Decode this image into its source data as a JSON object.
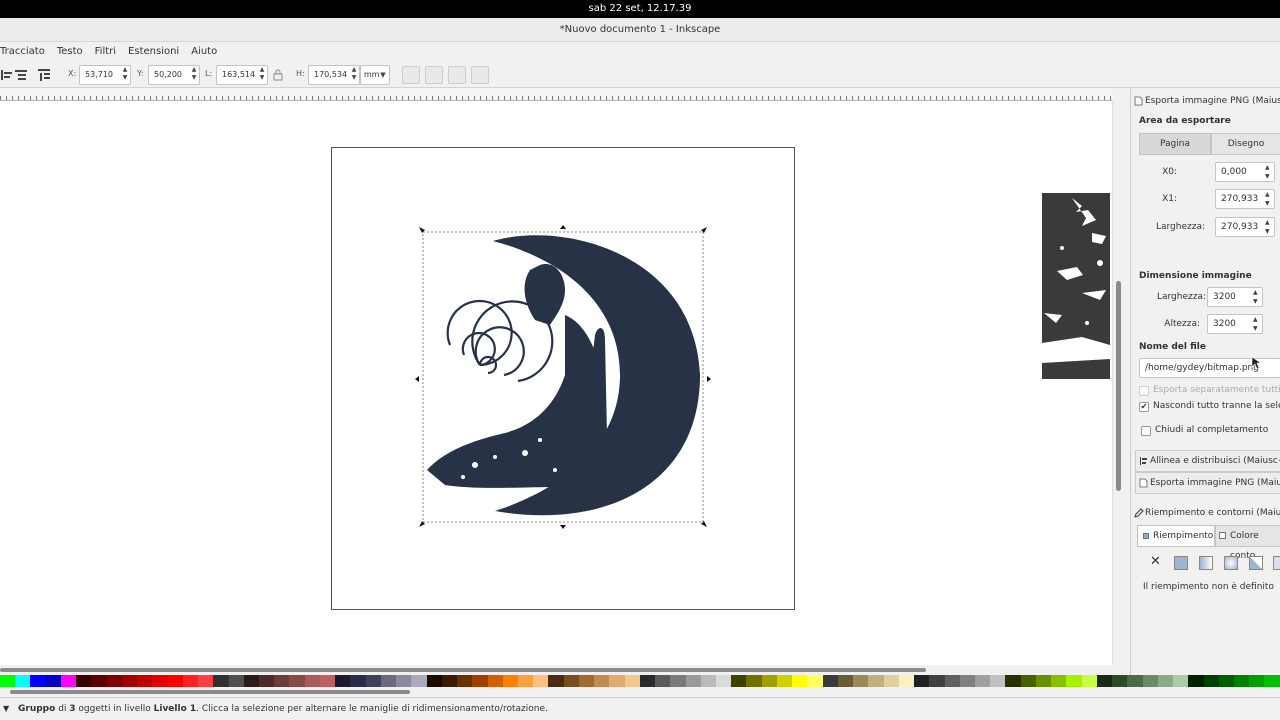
{
  "system": {
    "clock": "sab 22 set, 12.17.39"
  },
  "window": {
    "title": "*Nuovo documento 1 - Inkscape"
  },
  "menu": [
    "Tracciato",
    "Testo",
    "Filtri",
    "Estensioni",
    "Aiuto"
  ],
  "toolbar": {
    "x_label": "X:",
    "x_value": "53,710",
    "y_label": "Y:",
    "y_value": "50,200",
    "w_label": "L:",
    "w_value": "163,514",
    "h_label": "H:",
    "h_value": "170,534",
    "unit": "mm"
  },
  "export_panel": {
    "header": "Esporta immagine PNG (Maiusc+",
    "area_title": "Area da esportare",
    "tab_page": "Pagina",
    "tab_drawing": "Disegno",
    "x0_label": "X0:",
    "x0_value": "0,000",
    "x1_label": "X1:",
    "x1_value": "270,933",
    "width_label": "Larghezza:",
    "width_value": "270,933",
    "image_size_title": "Dimensione immagine",
    "img_width_label": "Larghezza:",
    "img_width_value": "3200",
    "img_height_label": "Altezza:",
    "img_height_value": "3200",
    "filename_title": "Nome del file",
    "filename_value": "/home/gydey/bitmap.png",
    "export_separately": "Esporta separatamente tutti gli",
    "hide_all_except": "Nascondi tutto tranne la selez",
    "close_when_done": "Chiudi al completamento",
    "hide_checked": true
  },
  "align_panel": {
    "header": "Allinea e distribuisci (Maiusc+C"
  },
  "export_panel_collapsed": {
    "header": "Esporta immagine PNG (Maiusc"
  },
  "fill_panel": {
    "header": "Riempimento e contorni (Maiusc",
    "tab_fill": "Riempimento",
    "tab_stroke": "Colore conto",
    "no_fill_icon": "x-icon",
    "undefined_text": "Il riempimento non è definito"
  },
  "status": {
    "prefix": "Gruppo",
    "di": "di",
    "count": "3",
    "objects_in_layer": "oggetti in livello",
    "layer": "Livello 1",
    "message": ". Clicca la selezione per alternare le maniglie di ridimensionamento/rotazione."
  },
  "colors": {
    "artwork": "#273247",
    "palette": [
      "#00ff00",
      "#00ffff",
      "#0000ff",
      "#0000c0",
      "#ff00ff",
      "#3b0000",
      "#5a0000",
      "#800000",
      "#a00000",
      "#c00000",
      "#e00000",
      "#ff0000",
      "#ff2020",
      "#ff4040",
      "#303030",
      "#505050",
      "#2b1a1a",
      "#4a2a2a",
      "#6b3a3a",
      "#8a4a4a",
      "#aa5a5a",
      "#c06060",
      "#1a1a2a",
      "#2a2a4a",
      "#40405a",
      "#6a6a7a",
      "#8a8a9a",
      "#aaaabb",
      "#1a0a00",
      "#3a1a00",
      "#6a3000",
      "#a04000",
      "#d06000",
      "#ff8000",
      "#ffa040",
      "#ffc080",
      "#4a2a10",
      "#7a4a20",
      "#a06a30",
      "#c08a50",
      "#e0aa70",
      "#f0c890",
      "#2a2a2a",
      "#5a5a5a",
      "#7a7a7a",
      "#9a9a9a",
      "#bababa",
      "#dadada",
      "#404000",
      "#707000",
      "#a0a000",
      "#d0d000",
      "#ffff00",
      "#ffff60",
      "#3a3a3a",
      "#6a5a3a",
      "#9a8a5a",
      "#c0b080",
      "#e0d0a0",
      "#f8f0c0",
      "#202020",
      "#404040",
      "#606060",
      "#808080",
      "#a0a0a0",
      "#c0c0c0",
      "#283000",
      "#486000",
      "#689000",
      "#88c000",
      "#a8f000",
      "#c8ff40",
      "#1a2a1a",
      "#2a4a2a",
      "#4a6a4a",
      "#6a8a6a",
      "#8aaa8a",
      "#aaccaa",
      "#002000",
      "#004000",
      "#006000",
      "#008000",
      "#00a000",
      "#00c000"
    ]
  }
}
